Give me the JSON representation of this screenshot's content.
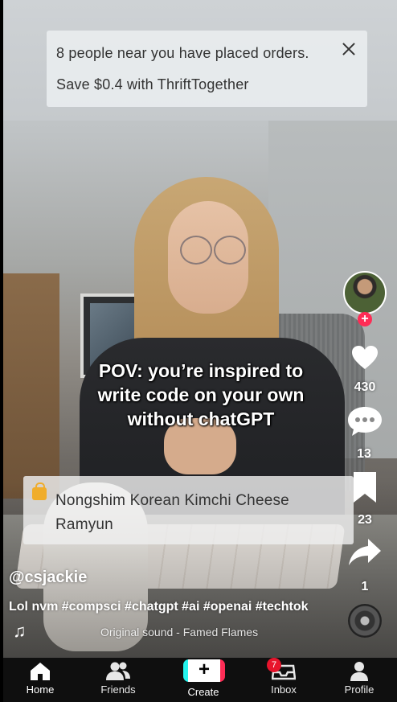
{
  "notification": {
    "line1": "8 people near you have placed orders.",
    "line2": "Save $0.4 with ThriftTogether"
  },
  "video": {
    "caption_lines": [
      "POV: you’re inspired to",
      "write code on your own",
      "without chatGPT"
    ]
  },
  "rail": {
    "likes": "430",
    "comments": "13",
    "saves": "23",
    "shares": "1",
    "follow_symbol": "+"
  },
  "product": {
    "title": "Nongshim Korean Kimchi Cheese Ramyun"
  },
  "post": {
    "username": "@csjackie",
    "description": "Lol nvm #compsci #chatgpt #ai #openai #techtok",
    "sound": "Original sound - Famed Flames",
    "music_icon": "♫"
  },
  "nav": {
    "home": "Home",
    "friends": "Friends",
    "create": "Create",
    "create_symbol": "+",
    "inbox": "Inbox",
    "inbox_badge": "7",
    "profile": "Profile"
  },
  "colors": {
    "accent_red": "#fe2c55",
    "accent_cyan": "#25f4ee",
    "badge_red": "#e8142c",
    "nav_bg": "#0f0f0f",
    "bag_yellow": "#f0ad2b"
  },
  "icons": {
    "close": "close-icon",
    "heart": "heart-icon",
    "comment": "comment-icon",
    "bookmark": "bookmark-icon",
    "share": "share-icon",
    "bag": "shopping-bag-icon",
    "music": "music-note-icon",
    "disc": "sound-disc-icon",
    "home": "home-icon",
    "friends": "friends-icon",
    "inbox": "inbox-icon",
    "profile": "profile-icon"
  }
}
